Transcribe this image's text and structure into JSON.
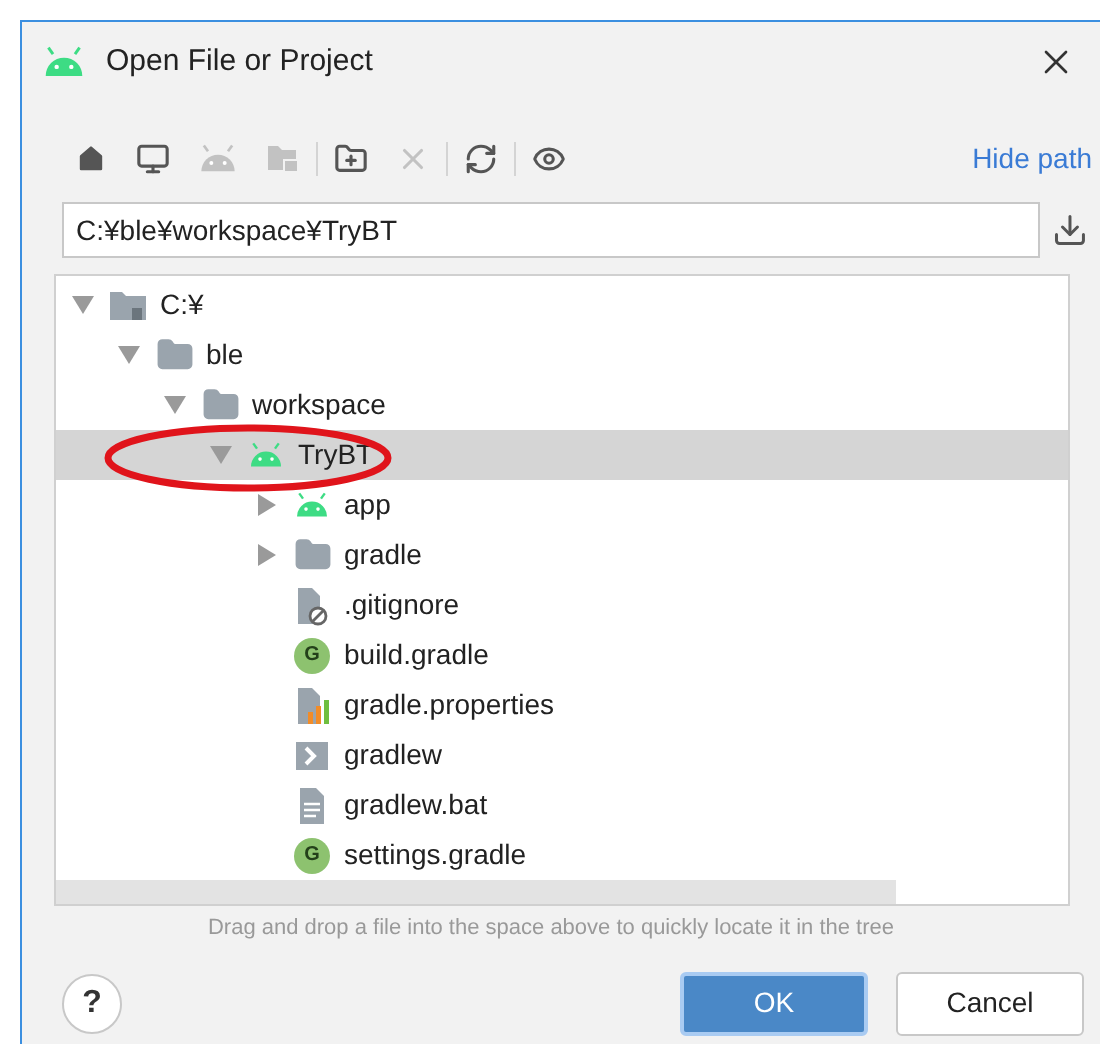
{
  "window": {
    "title": "Open File or Project"
  },
  "toolbar": {
    "groups": [
      [
        {
          "kind": "home",
          "disabled": false
        },
        {
          "kind": "desktop",
          "disabled": false
        },
        {
          "kind": "android",
          "disabled": true
        },
        {
          "kind": "module",
          "disabled": true
        }
      ],
      [
        {
          "kind": "new-folder",
          "disabled": false
        },
        {
          "kind": "delete",
          "disabled": true
        }
      ],
      [
        {
          "kind": "refresh",
          "disabled": false
        }
      ],
      [
        {
          "kind": "show-hidden",
          "disabled": false
        }
      ]
    ],
    "link": "Hide path"
  },
  "path_field": {
    "value": "C:¥ble¥workspace¥TryBT"
  },
  "tree": [
    {
      "label": "C:¥",
      "kind": "drive",
      "expanded": true,
      "selected": false,
      "children": [
        {
          "label": "ble",
          "kind": "folder",
          "expanded": true,
          "selected": false,
          "children": [
            {
              "label": "workspace",
              "kind": "folder",
              "expanded": true,
              "selected": false,
              "children": [
                {
                  "label": "TryBT",
                  "kind": "android",
                  "expanded": true,
                  "selected": true,
                  "highlighted": true,
                  "children": [
                    {
                      "label": "app",
                      "kind": "android",
                      "expanded": false,
                      "selected": false
                    },
                    {
                      "label": "gradle",
                      "kind": "folder",
                      "expanded": false,
                      "selected": false
                    },
                    {
                      "label": ".gitignore",
                      "kind": "ignored",
                      "selected": false
                    },
                    {
                      "label": "build.gradle",
                      "kind": "gradle",
                      "badge": "G",
                      "selected": false
                    },
                    {
                      "label": "gradle.properties",
                      "kind": "properties",
                      "selected": false
                    },
                    {
                      "label": "gradlew",
                      "kind": "script",
                      "selected": false
                    },
                    {
                      "label": "gradlew.bat",
                      "kind": "text",
                      "selected": false
                    },
                    {
                      "label": "settings.gradle",
                      "kind": "gradle",
                      "badge": "G",
                      "selected": false
                    }
                  ]
                }
              ]
            }
          ]
        }
      ]
    }
  ],
  "hint": "Drag and drop a file into the space above to quickly locate it in the tree",
  "help_button": {
    "label": "?"
  },
  "buttons": [
    {
      "label": "OK",
      "primary": true
    },
    {
      "label": "Cancel",
      "primary": false
    }
  ]
}
